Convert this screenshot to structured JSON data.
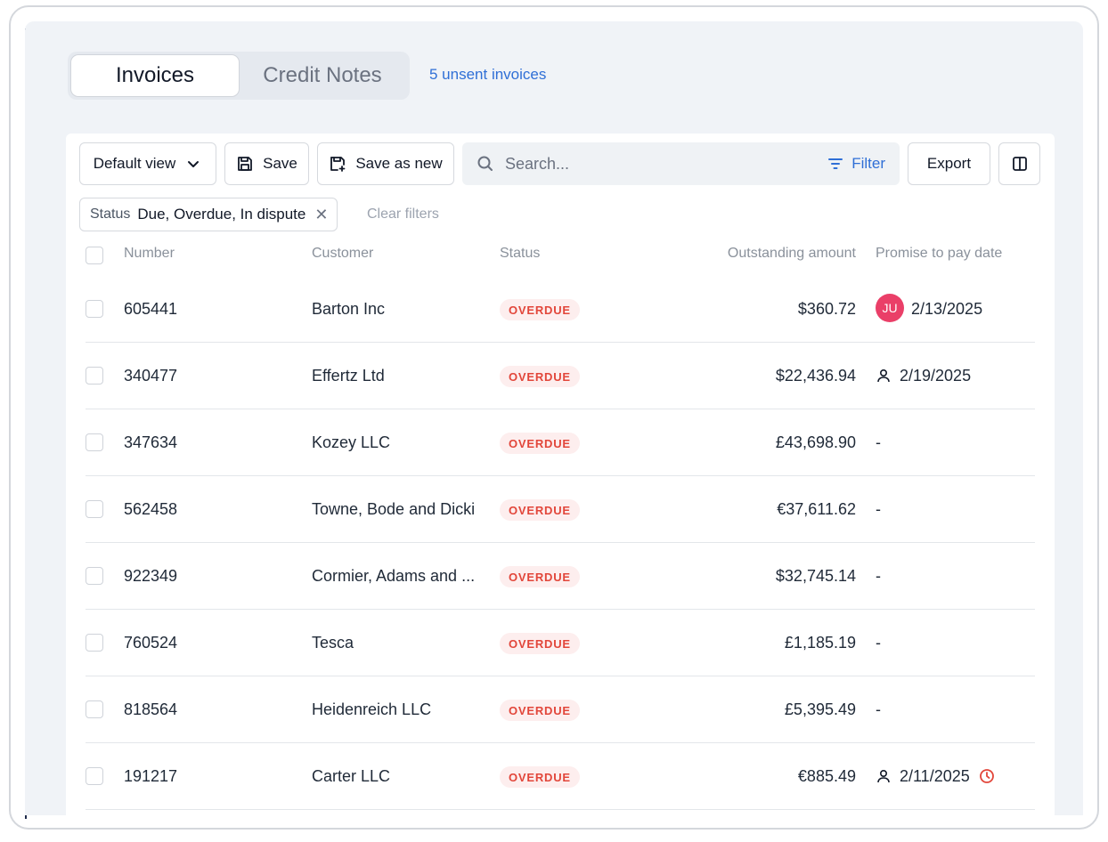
{
  "tabs": [
    {
      "label": "Invoices",
      "active": true
    },
    {
      "label": "Credit Notes",
      "active": false
    }
  ],
  "unsent_link": "5 unsent invoices",
  "toolbar": {
    "default_view": "Default view",
    "save": "Save",
    "save_as_new": "Save as new",
    "search_placeholder": "Search...",
    "filter": "Filter",
    "export": "Export"
  },
  "filter_chip": {
    "key": "Status",
    "value": "Due, Overdue, In dispute"
  },
  "clear_filters": "Clear filters",
  "columns": {
    "number": "Number",
    "customer": "Customer",
    "status": "Status",
    "amount": "Outstanding amount",
    "promise": "Promise to pay date"
  },
  "rows": [
    {
      "number": "605441",
      "customer": "Barton Inc",
      "status": "OVERDUE",
      "amount": "$360.72",
      "promise": "2/13/2025",
      "promise_marker": "avatar",
      "avatar_initials": "JU"
    },
    {
      "number": "340477",
      "customer": "Effertz Ltd",
      "status": "OVERDUE",
      "amount": "$22,436.94",
      "promise": "2/19/2025",
      "promise_marker": "person-icon"
    },
    {
      "number": "347634",
      "customer": "Kozey LLC",
      "status": "OVERDUE",
      "amount": "£43,698.90",
      "promise": "-"
    },
    {
      "number": "562458",
      "customer": "Towne, Bode and Dicki",
      "status": "OVERDUE",
      "amount": "€37,611.62",
      "promise": "-"
    },
    {
      "number": "922349",
      "customer": "Cormier, Adams and ...",
      "status": "OVERDUE",
      "amount": "$32,745.14",
      "promise": "-"
    },
    {
      "number": "760524",
      "customer": "Tesca",
      "status": "OVERDUE",
      "amount": "£1,185.19",
      "promise": "-"
    },
    {
      "number": "818564",
      "customer": "Heidenreich LLC",
      "status": "OVERDUE",
      "amount": "£5,395.49",
      "promise": "-"
    },
    {
      "number": "191217",
      "customer": "Carter LLC",
      "status": "OVERDUE",
      "amount": "€885.49",
      "promise": "2/11/2025",
      "promise_marker": "person-icon",
      "overdue_promise": "clock-icon"
    }
  ],
  "colors": {
    "accent": "#2f6fd6",
    "overdue": "#e2463a",
    "avatar": "#ea3f68"
  }
}
